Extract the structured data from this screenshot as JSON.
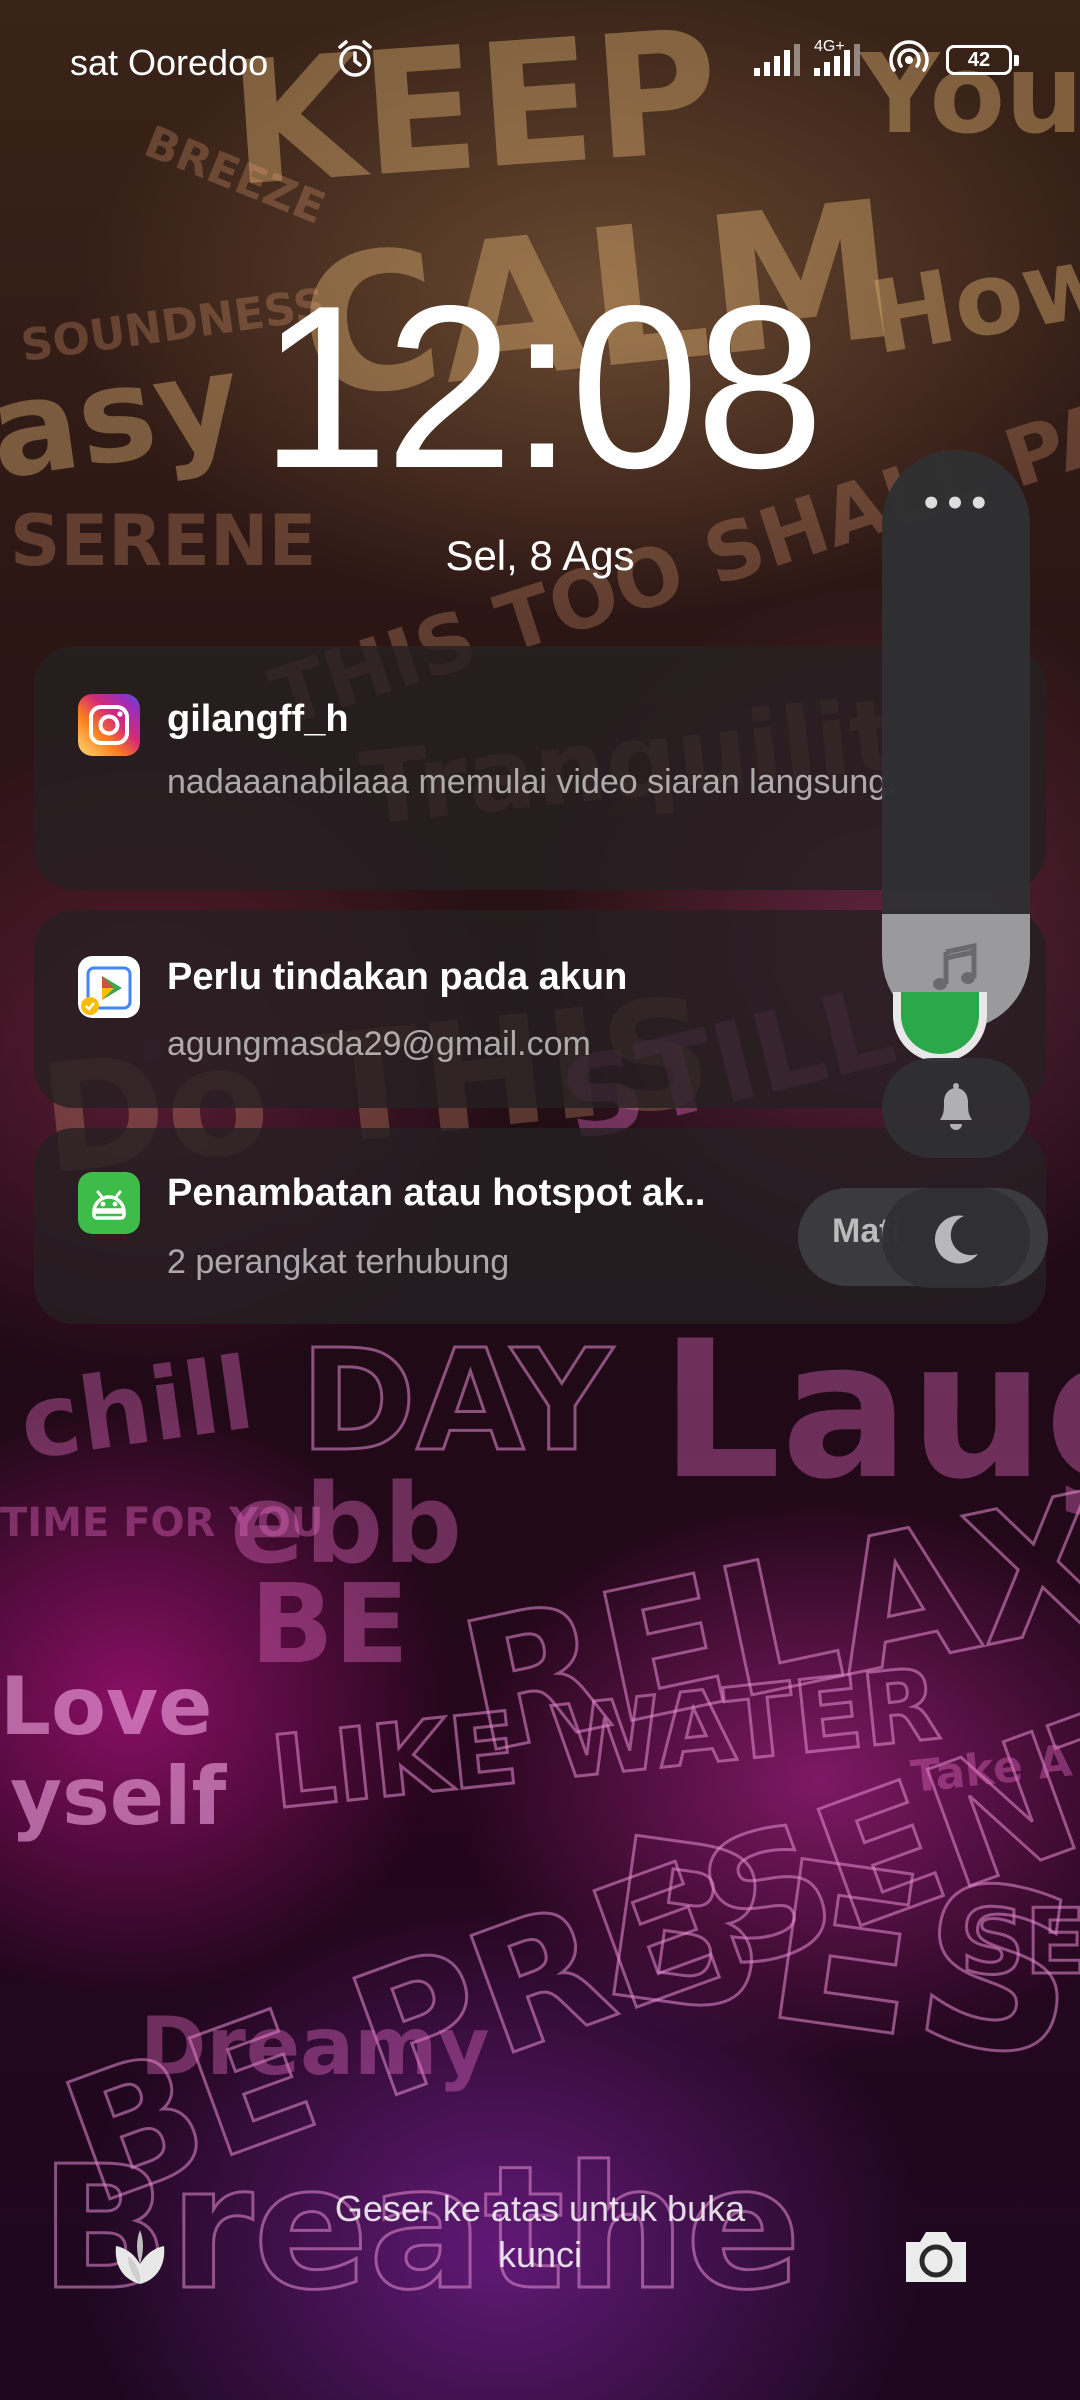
{
  "status_bar": {
    "carrier": "sat Ooredoo",
    "network_type": "4G+",
    "battery": "42",
    "icons": [
      "alarm-icon",
      "signal-icon",
      "signal-icon",
      "hotspot-icon",
      "battery-icon"
    ]
  },
  "lockscreen": {
    "time": "12:08",
    "date": "Sel, 8 Ags",
    "unlock_hint_line1": "Geser ke atas untuk buka",
    "unlock_hint_line2": "kunci"
  },
  "notifications": [
    {
      "app_icon": "instagram-icon",
      "title": "gilangff_h",
      "body": "nadaaanabilaaa memulai video siaran langsung."
    },
    {
      "app_icon": "google-play-icon",
      "title": "Perlu tindakan pada akun",
      "body": "agungmasda29@gmail.com"
    },
    {
      "app_icon": "android-hotspot-icon",
      "title": "Penambatan atau hotspot ak..",
      "body": "2 perangkat terhubung"
    }
  ],
  "volume_panel": {
    "more_label": "•••",
    "level": 0.2,
    "dnd_label": "Mati",
    "icons": [
      "music-icon",
      "bell-icon",
      "moon-icon"
    ]
  },
  "shortcuts": {
    "left": "flower-icon",
    "right": "camera-icon"
  },
  "colors": {
    "notification_bg": "#262022",
    "volume_panel_bg": "#303032",
    "accent_green": "#2aa84a"
  }
}
